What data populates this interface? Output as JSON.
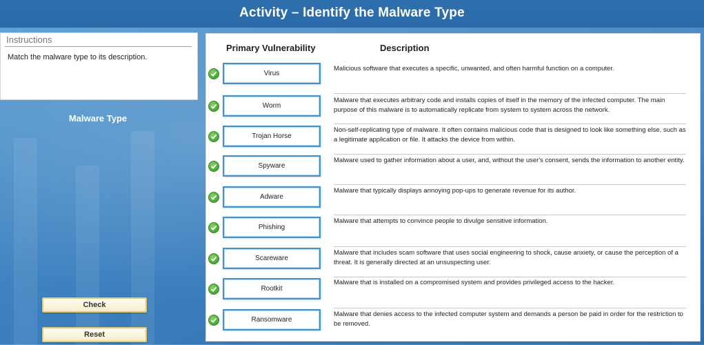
{
  "title": "Activity – Identify the Malware Type",
  "instructions": {
    "heading": "Instructions",
    "text": "Match the malware type to its description."
  },
  "side_label": "Malware Type",
  "columns": {
    "vulnerability": "Primary Vulnerability",
    "description": "Description"
  },
  "rows": [
    {
      "answer": "Virus",
      "description": "Malicious software that executes a specific, unwanted, and often harmful function on a computer."
    },
    {
      "answer": "Worm",
      "description": "Malware that executes arbitrary code and installs copies of itself in the memory of the infected computer. The main purpose of this malware is to automatically replicate from system to system across the network."
    },
    {
      "answer": "Trojan Horse",
      "description": "Non-self-replicating type of malware. It often contains malicious code that is designed to look like something else, such as a legitimate application or file. It attacks the device from within."
    },
    {
      "answer": "Spyware",
      "description": "Malware used to gather information about a user, and, without the user's consent, sends the information to another entity."
    },
    {
      "answer": "Adware",
      "description": "Malware that typically displays annoying pop-ups to generate revenue for its author."
    },
    {
      "answer": "Phishing",
      "description": "Malware that attempts to convince people to divulge sensitive information."
    },
    {
      "answer": "Scareware",
      "description": "Malware that includes scam software that uses social engineering to shock, cause anxiety, or cause the perception of a threat. It is generally directed at an unsuspecting user."
    },
    {
      "answer": "Rootkit",
      "description": "Malware that is installed on a compromised system and provides privileged access to the hacker."
    },
    {
      "answer": "Ransomware",
      "description": "Malware that denies access to the infected computer system and demands a person be paid in order for the restriction to be removed."
    }
  ],
  "buttons": {
    "check": "Check",
    "reset": "Reset"
  },
  "colors": {
    "accent": "#3c92d6",
    "correct": "#4caf3a",
    "button_border": "#e7c96a"
  }
}
